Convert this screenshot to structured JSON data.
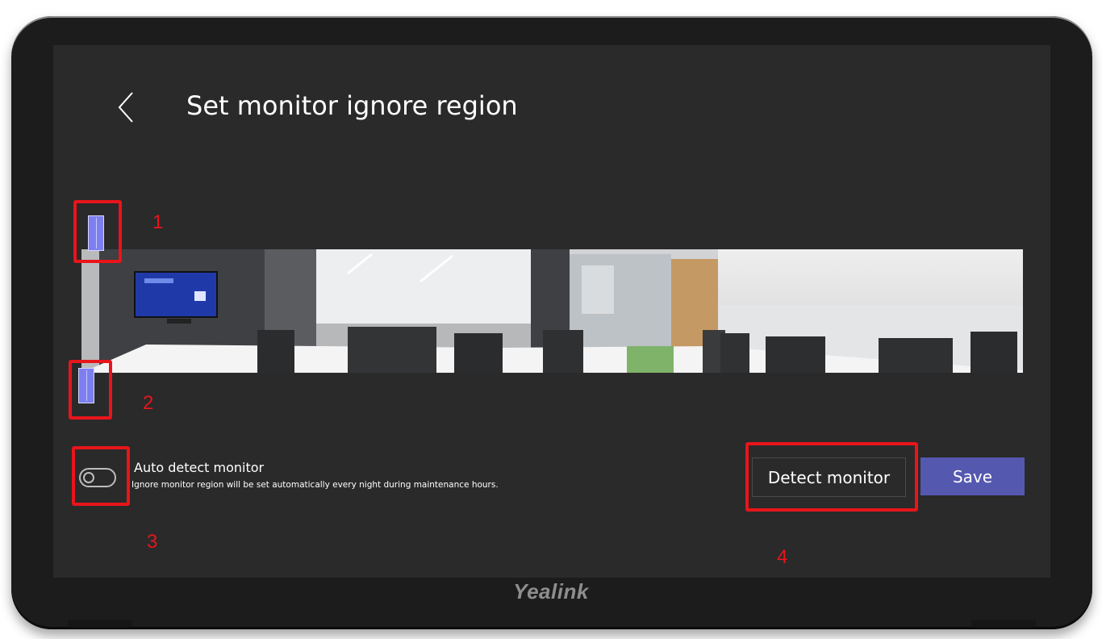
{
  "header": {
    "title": "Set monitor ignore region"
  },
  "markers": {
    "m1": "1",
    "m2": "2",
    "m3": "3",
    "m4": "4"
  },
  "settings": {
    "auto_detect_label": "Auto detect monitor",
    "auto_detect_description": "Ignore monitor region will be set automatically every night during maintenance hours.",
    "auto_detect_enabled": false
  },
  "buttons": {
    "detect_label": "Detect monitor",
    "save_label": "Save"
  },
  "brand": {
    "logo_text": "Yealink"
  },
  "colors": {
    "screen_bg": "#2a2a2a",
    "accent": "#5558af",
    "handle": "#7d7ff0",
    "highlight": "#e8151b"
  },
  "icons": {
    "back": "chevron-left-icon"
  }
}
